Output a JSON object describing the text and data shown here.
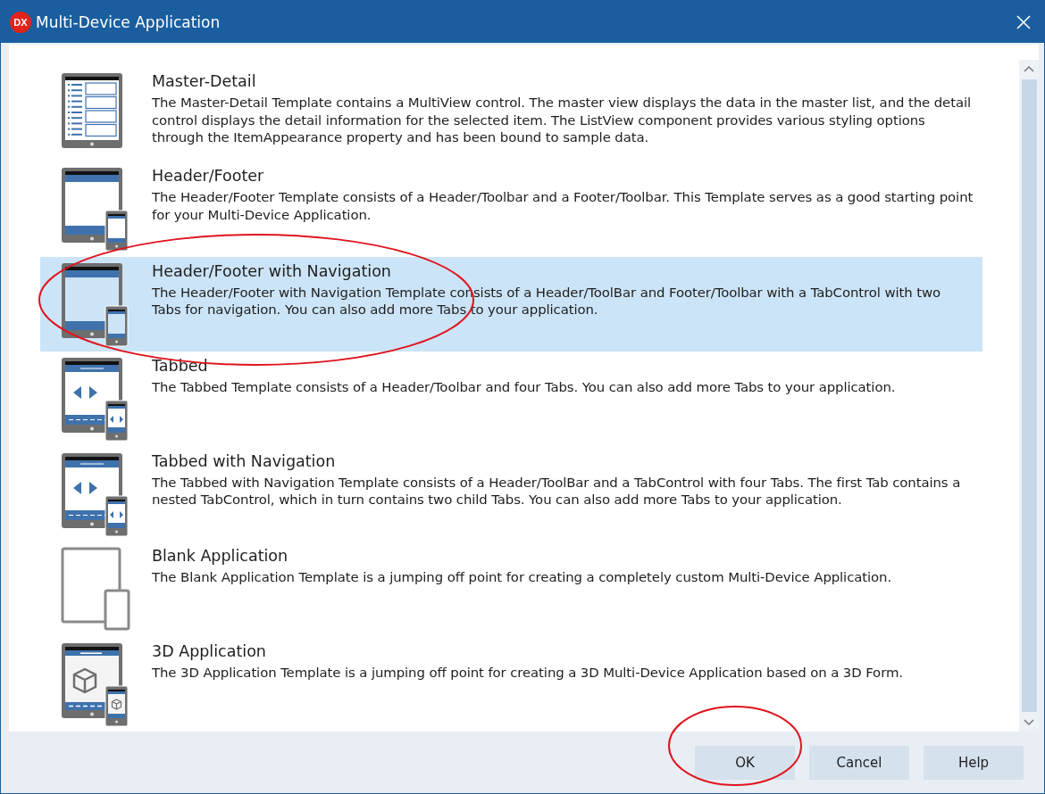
{
  "window": {
    "logo_text": "DX",
    "title": "Multi-Device Application"
  },
  "templates": [
    {
      "kind": "master_detail",
      "title": "Master-Detail",
      "description": "The Master-Detail Template contains a MultiView control. The master view displays the data in the master list, and the detail control displays the detail information for the selected item. The ListView component provides various styling options through the ItemAppearance property and has been bound to sample data.",
      "selected": false
    },
    {
      "kind": "header_footer",
      "title": "Header/Footer",
      "description": "The Header/Footer Template consists of a Header/Toolbar and a Footer/Toolbar. This Template serves as a good starting point for your Multi-Device Application.",
      "selected": false
    },
    {
      "kind": "header_footer",
      "title": "Header/Footer with Navigation",
      "description": "The Header/Footer with Navigation Template consists of a Header/ToolBar and Footer/Toolbar with a TabControl with two Tabs for navigation.  You can also add more Tabs to your application.",
      "selected": true
    },
    {
      "kind": "tabbed",
      "title": "Tabbed",
      "description": "The Tabbed Template consists of a Header/Toolbar and four Tabs.  You can also add more Tabs to your application.",
      "selected": false
    },
    {
      "kind": "tabbed",
      "title": "Tabbed with Navigation",
      "description": "The Tabbed with Navigation Template consists of a Header/ToolBar and a TabControl with four Tabs. The first Tab contains a nested TabControl, which in turn contains two child Tabs. You can also add more Tabs to your application.",
      "selected": false
    },
    {
      "kind": "blank",
      "title": "Blank Application",
      "description": "The Blank Application Template is a jumping off point for creating a completely custom Multi-Device Application.",
      "selected": false
    },
    {
      "kind": "cube",
      "title": "3D Application",
      "description": "The 3D Application Template is a jumping off point for creating a 3D Multi-Device Application based on a 3D Form.",
      "selected": false
    }
  ],
  "buttons": [
    {
      "label": "OK"
    },
    {
      "label": "Cancel"
    },
    {
      "label": "Help"
    }
  ]
}
